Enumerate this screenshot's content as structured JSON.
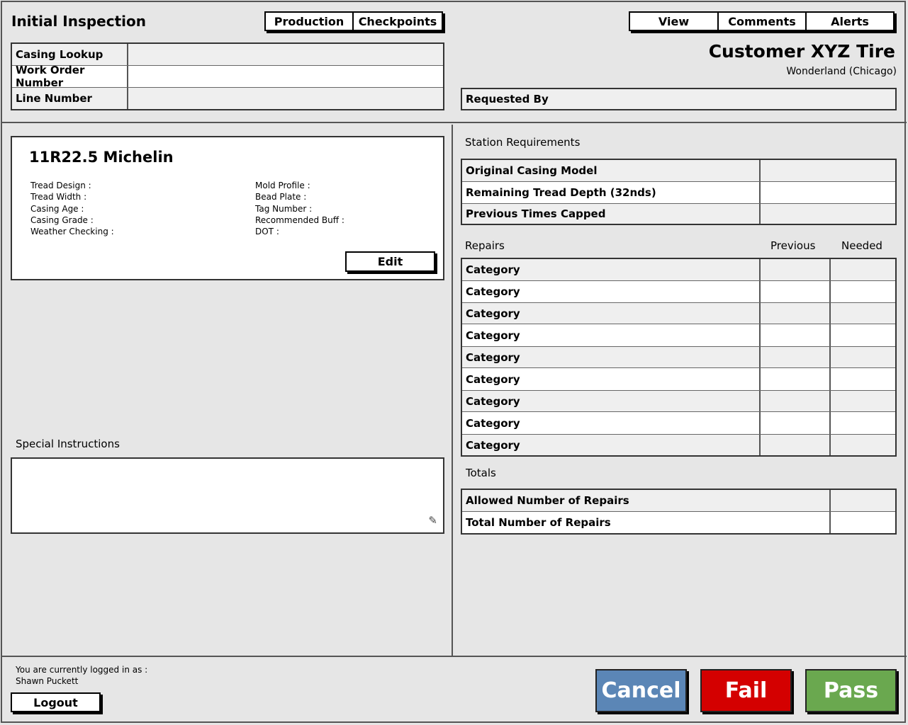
{
  "header": {
    "title": "Initial Inspection",
    "left_tabs": [
      "Production",
      "Checkpoints"
    ],
    "right_tabs": [
      "View",
      "Comments",
      "Alerts"
    ]
  },
  "lookup": {
    "casing_lookup": "Casing Lookup",
    "work_order_number": "Work Order Number",
    "line_number": "Line Number"
  },
  "customer": {
    "name": "Customer XYZ Tire",
    "location": "Wonderland (Chicago)",
    "requested_by_label": "Requested By"
  },
  "tire": {
    "title": "11R22.5 Michelin",
    "left_fields": [
      "Tread Design :",
      "Tread Width :",
      "Casing Age :",
      "Casing Grade :",
      "Weather Checking :"
    ],
    "right_fields": [
      "Mold Profile :",
      "Bead Plate :",
      "Tag Number :",
      "Recommended Buff :",
      "DOT :"
    ],
    "edit_label": "Edit"
  },
  "special_instructions": {
    "label": "Special Instructions",
    "value": ""
  },
  "station": {
    "heading": "Station Requirements",
    "rows": [
      "Original Casing Model",
      "Remaining Tread Depth (32nds)",
      "Previous Times Capped"
    ]
  },
  "repairs": {
    "heading": "Repairs",
    "col_previous": "Previous",
    "col_needed": "Needed",
    "rows": [
      "Category",
      "Category",
      "Category",
      "Category",
      "Category",
      "Category",
      "Category",
      "Category",
      "Category"
    ]
  },
  "totals": {
    "heading": "Totals",
    "rows": [
      "Allowed Number of Repairs",
      "Total Number of Repairs"
    ]
  },
  "footer": {
    "logged_in_text": "You are currently logged in as :",
    "user_name": "Shawn Puckett",
    "logout_label": "Logout",
    "cancel_label": "Cancel",
    "fail_label": "Fail",
    "pass_label": "Pass"
  },
  "colors": {
    "cancel": "#5b86b6",
    "fail": "#d40000",
    "pass": "#6aa84f"
  }
}
